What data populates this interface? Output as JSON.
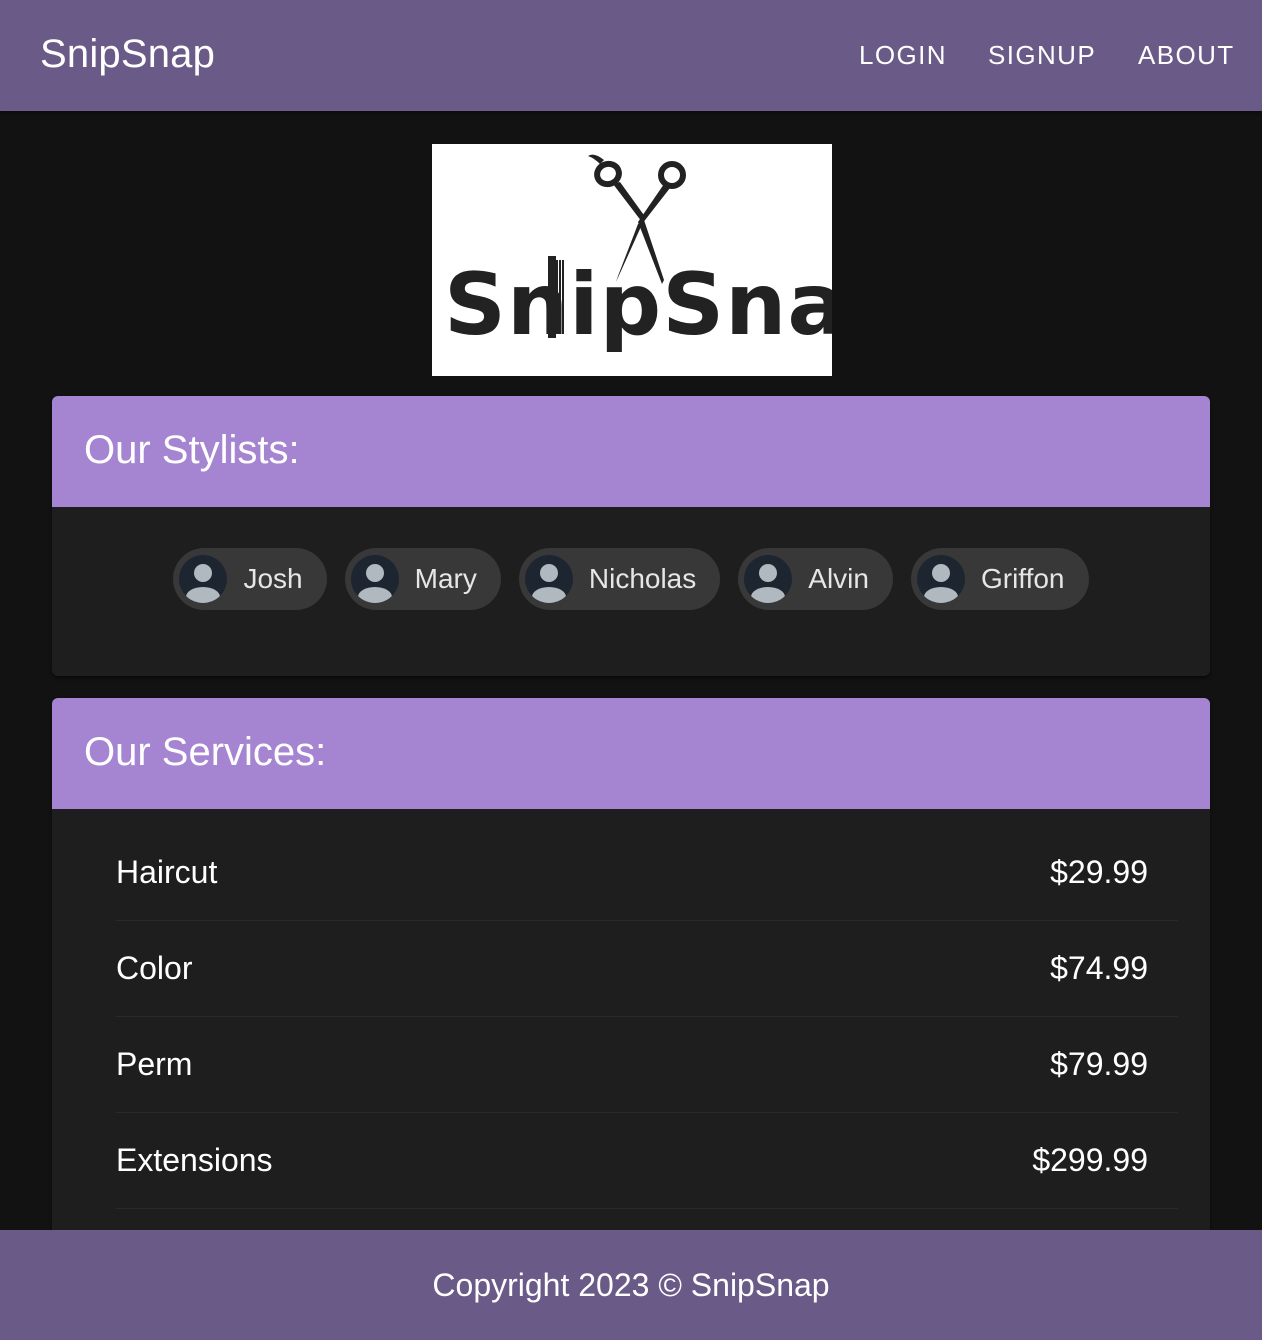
{
  "appbar": {
    "brand": "SnipSnap",
    "nav": [
      {
        "label": "LOGIN"
      },
      {
        "label": "SIGNUP"
      },
      {
        "label": "ABOUT"
      }
    ]
  },
  "logo": {
    "text": "SnipSnap"
  },
  "stylists": {
    "title": "Our Stylists:",
    "items": [
      {
        "name": "Josh"
      },
      {
        "name": "Mary"
      },
      {
        "name": "Nicholas"
      },
      {
        "name": "Alvin"
      },
      {
        "name": "Griffon"
      }
    ]
  },
  "services": {
    "title": "Our Services:",
    "items": [
      {
        "name": "Haircut",
        "price": "$29.99"
      },
      {
        "name": "Color",
        "price": "$74.99"
      },
      {
        "name": "Perm",
        "price": "$79.99"
      },
      {
        "name": "Extensions",
        "price": "$299.99"
      }
    ]
  },
  "footer": {
    "text": "Copyright 2023 © SnipSnap"
  },
  "colors": {
    "appbar": "#6a5a87",
    "card_header": "#a585d1",
    "background": "#121212",
    "card": "#1e1e1e"
  }
}
